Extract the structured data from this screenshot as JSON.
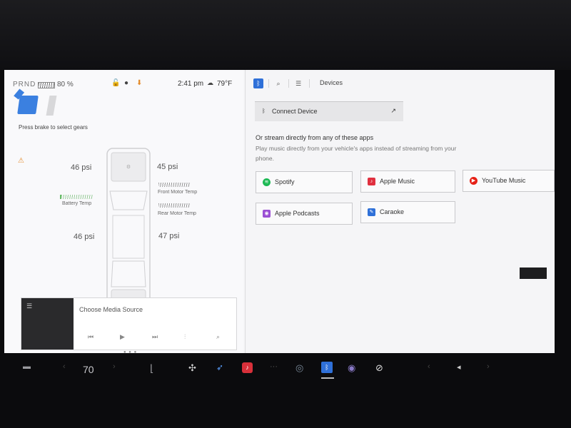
{
  "status": {
    "gears": "PRND",
    "battery_percent": "80 %",
    "battery_level": 0.8,
    "time": "2:41 pm",
    "temperature": "79°F"
  },
  "left": {
    "press_brake": "Press brake to select gears",
    "tires": {
      "front_left": "46 psi",
      "front_right": "45 psi",
      "rear_left": "46 psi",
      "rear_right": "47 psi"
    },
    "battery_temp_label": "Battery Temp",
    "front_motor_label": "Front Motor Temp",
    "rear_motor_label": "Rear Motor Temp"
  },
  "media": {
    "title": "Choose Media Source",
    "icons": [
      "queue-icon",
      "previous-icon",
      "play-icon",
      "next-icon",
      "equalizer-icon",
      "search-icon"
    ]
  },
  "right": {
    "tab_title": "Devices",
    "connect_label": "Connect Device",
    "stream_title": "Or stream directly from any of these apps",
    "stream_desc": "Play music directly from your vehicle's apps instead of streaming from your phone.",
    "apps": [
      {
        "label": "Spotify",
        "color": "#1db954"
      },
      {
        "label": "Apple Music",
        "color": "#e0303f"
      },
      {
        "label": "YouTube Music",
        "color": "#e62117"
      },
      {
        "label": "Apple Podcasts",
        "color": "#9b4fd4"
      },
      {
        "label": "Caraoke",
        "color": "#2f70d8"
      }
    ]
  },
  "dock": {
    "speed": "70"
  },
  "colors": {
    "accent": "#2f70d8",
    "warning": "#e48c2c"
  }
}
